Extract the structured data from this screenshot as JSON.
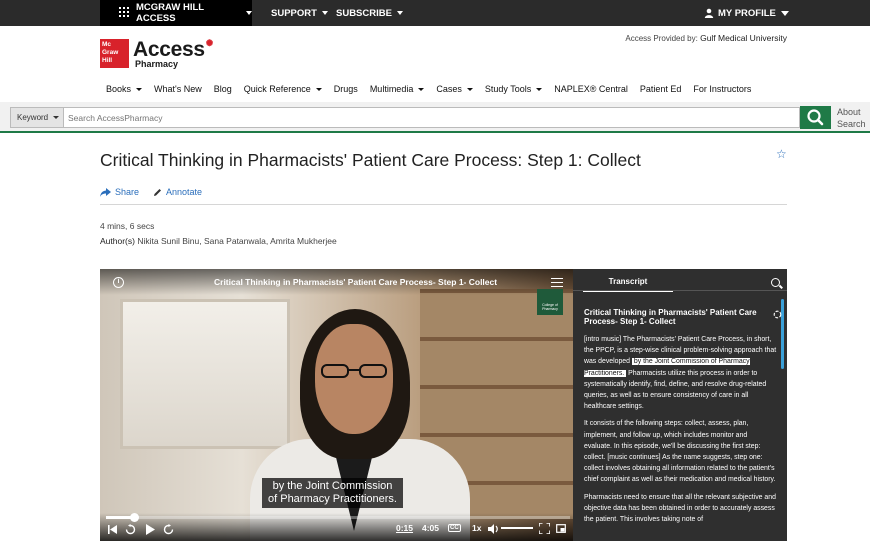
{
  "topbar": {
    "access_label": "MCGRAW HILL ACCESS",
    "support_label": "SUPPORT",
    "subscribe_label": "SUBSCRIBE",
    "profile_label": "MY PROFILE"
  },
  "header": {
    "logo_text": "Mc Graw Hill",
    "brand": "Access",
    "brand_sub": "Pharmacy",
    "provided_prefix": "Access Provided by:",
    "provided_by": "Gulf Medical University"
  },
  "nav": {
    "items": [
      "Books",
      "What's New",
      "Blog",
      "Quick Reference",
      "Drugs",
      "Multimedia",
      "Cases",
      "Study Tools",
      "NAPLEX® Central",
      "Patient Ed",
      "For Instructors"
    ]
  },
  "search": {
    "scope": "Keyword",
    "placeholder": "Search AccessPharmacy",
    "about_line1": "About",
    "about_line2": "Search"
  },
  "article": {
    "title": "Critical Thinking in Pharmacists' Patient Care Process: Step 1: Collect",
    "share_label": "Share",
    "annotate_label": "Annotate",
    "duration": "4 mins, 6 secs",
    "authors_label": "Author(s)",
    "authors": "Nikita Sunil Binu, Sana Patanwala, Amrita Mukherjee"
  },
  "player": {
    "video_title": "Critical Thinking in Pharmacists' Patient Care Process- Step 1- Collect",
    "college_label": "College of Pharmacy",
    "caption_line1": "by the Joint Commission",
    "caption_line2": "of Pharmacy Practitioners.",
    "current_time": "0:15",
    "total_time": "4:05",
    "speed": "1x",
    "progress": 0.06,
    "transcript_tab": "Transcript",
    "transcript_title": "Critical Thinking in Pharmacists' Patient Care Process- Step 1- Collect",
    "transcript_p1_a": "[intro music]  The Pharmacists' Patient Care Process,  in short, the PPCP,  is a step-wise clinical problem-solving approach  that was developed ",
    "transcript_p1_hl": "by the Joint Commission of Pharmacy Practitioners.",
    "transcript_p1_b": "  Pharmacists utilize this process  in order to systematically identify,  find, define, and resolve drug-related queries,  as well as to ensure consistency of care  in all healthcare settings.",
    "transcript_p2": "It consists of the following steps:  collect, assess, plan, implement, and follow up,  which includes monitor and evaluate.  In this episode,  we'll be discussing the first step: collect.  [music continues]  As the name suggests, step one: collect  involves obtaining all information  related to the patient's chief complaint  as well as their medication and medical history.",
    "transcript_p3": "Pharmacists need to ensure that all the relevant subjective and objective data has been obtained  in order to accurately assess the patient.  This involves taking note of"
  }
}
